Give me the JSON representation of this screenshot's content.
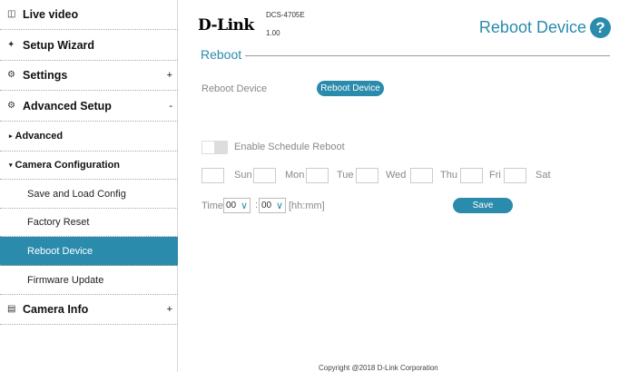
{
  "sidebar": {
    "items": [
      {
        "label": "Live video",
        "icon": "video-icon"
      },
      {
        "label": "Setup Wizard",
        "icon": "wand-icon"
      },
      {
        "label": "Settings",
        "icon": "gear-icon",
        "sign": "+"
      },
      {
        "label": "Advanced Setup",
        "icon": "gears-icon",
        "sign": "-"
      },
      {
        "label": "Advanced",
        "bullet": "▸"
      },
      {
        "label": "Camera Configuration",
        "bullet": "▾"
      },
      {
        "label": "Save and Load Config"
      },
      {
        "label": "Factory Reset"
      },
      {
        "label": "Reboot Device",
        "active": true
      },
      {
        "label": "Firmware Update"
      },
      {
        "label": "Camera Info",
        "icon": "document-icon",
        "sign": "+"
      }
    ]
  },
  "header": {
    "logo": "D-Link",
    "model": "DCS-4705E",
    "firmware": "1.00",
    "title": "Reboot Device",
    "help": "?"
  },
  "section": {
    "title": "Reboot"
  },
  "reboot": {
    "label": "Reboot Device",
    "button": "Reboot Device"
  },
  "schedule": {
    "toggle_label": "Enable Schedule Reboot",
    "enabled": false,
    "days": [
      "Sun",
      "Mon",
      "Tue",
      "Wed",
      "Thu",
      "Fri",
      "Sat"
    ],
    "time_label": "Time",
    "hour": "00",
    "minute": "00",
    "separator": ":",
    "format": "[hh:mm]",
    "save": "Save"
  },
  "footer": {
    "copyright": "Copyright @2018 D-Link Corporation"
  },
  "colors": {
    "accent": "#2a8bac"
  }
}
